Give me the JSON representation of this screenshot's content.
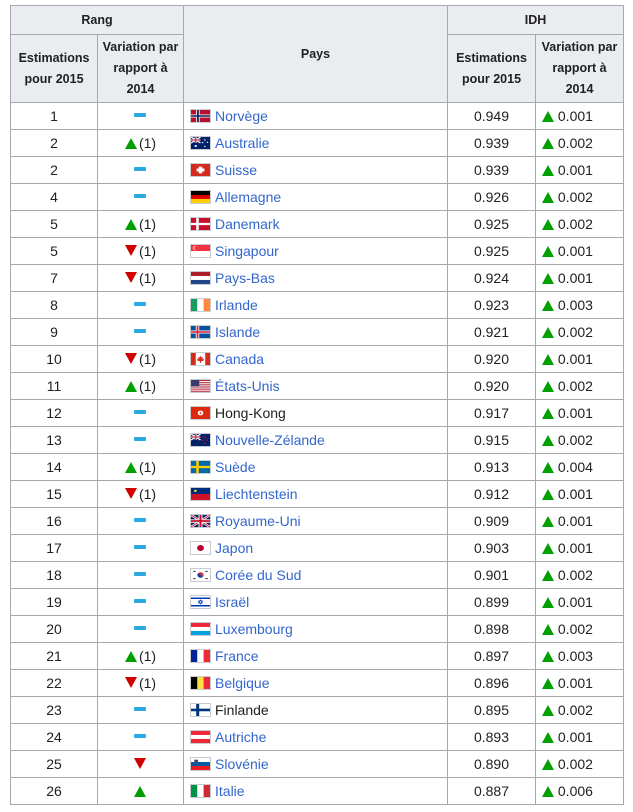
{
  "header": {
    "rang": "Rang",
    "pays": "Pays",
    "idh": "IDH",
    "estimations": "Estimations pour 2015",
    "variation": "Variation par rapport à 2014"
  },
  "colors": {
    "up": "#00a000",
    "down": "#d00000",
    "same": "#2aa9e0",
    "link": "#3366cc"
  },
  "rows": [
    {
      "rank": "1",
      "change": "same",
      "change_text": "",
      "country": "Norvège",
      "flag": "norway-flag",
      "idh": "0.949",
      "idh_change": "0.001"
    },
    {
      "rank": "2",
      "change": "up",
      "change_text": "(1)",
      "country": "Australie",
      "flag": "australia-flag",
      "idh": "0.939",
      "idh_change": "0.002"
    },
    {
      "rank": "2",
      "change": "same",
      "change_text": "",
      "country": "Suisse",
      "flag": "switzerland-flag",
      "idh": "0.939",
      "idh_change": "0.001"
    },
    {
      "rank": "4",
      "change": "same",
      "change_text": "",
      "country": "Allemagne",
      "flag": "germany-flag",
      "idh": "0.926",
      "idh_change": "0.002"
    },
    {
      "rank": "5",
      "change": "up",
      "change_text": "(1)",
      "country": "Danemark",
      "flag": "denmark-flag",
      "idh": "0.925",
      "idh_change": "0.002"
    },
    {
      "rank": "5",
      "change": "down",
      "change_text": "(1)",
      "country": "Singapour",
      "flag": "singapore-flag",
      "idh": "0.925",
      "idh_change": "0.001"
    },
    {
      "rank": "7",
      "change": "down",
      "change_text": "(1)",
      "country": "Pays-Bas",
      "flag": "netherlands-flag",
      "idh": "0.924",
      "idh_change": "0.001"
    },
    {
      "rank": "8",
      "change": "same",
      "change_text": "",
      "country": "Irlande",
      "flag": "ireland-flag",
      "idh": "0.923",
      "idh_change": "0.003"
    },
    {
      "rank": "9",
      "change": "same",
      "change_text": "",
      "country": "Islande",
      "flag": "iceland-flag",
      "idh": "0.921",
      "idh_change": "0.002"
    },
    {
      "rank": "10",
      "change": "down",
      "change_text": "(1)",
      "country": "Canada",
      "flag": "canada-flag",
      "idh": "0.920",
      "idh_change": "0.001"
    },
    {
      "rank": "11",
      "change": "up",
      "change_text": "(1)",
      "country": "États-Unis",
      "flag": "usa-flag",
      "idh": "0.920",
      "idh_change": "0.002"
    },
    {
      "rank": "12",
      "change": "same",
      "change_text": "",
      "country": "Hong-Kong",
      "flag": "hongkong-flag",
      "idh": "0.917",
      "idh_change": "0.001"
    },
    {
      "rank": "13",
      "change": "same",
      "change_text": "",
      "country": "Nouvelle-Zélande",
      "flag": "newzealand-flag",
      "idh": "0.915",
      "idh_change": "0.002"
    },
    {
      "rank": "14",
      "change": "up",
      "change_text": "(1)",
      "country": "Suède",
      "flag": "sweden-flag",
      "idh": "0.913",
      "idh_change": "0.004"
    },
    {
      "rank": "15",
      "change": "down",
      "change_text": "(1)",
      "country": "Liechtenstein",
      "flag": "liechtenstein-flag",
      "idh": "0.912",
      "idh_change": "0.001"
    },
    {
      "rank": "16",
      "change": "same",
      "change_text": "",
      "country": "Royaume-Uni",
      "flag": "uk-flag",
      "idh": "0.909",
      "idh_change": "0.001"
    },
    {
      "rank": "17",
      "change": "same",
      "change_text": "",
      "country": "Japon",
      "flag": "japan-flag",
      "idh": "0.903",
      "idh_change": "0.001"
    },
    {
      "rank": "18",
      "change": "same",
      "change_text": "",
      "country": "Corée du Sud",
      "flag": "southkorea-flag",
      "idh": "0.901",
      "idh_change": "0.002"
    },
    {
      "rank": "19",
      "change": "same",
      "change_text": "",
      "country": "Israël",
      "flag": "israel-flag",
      "idh": "0.899",
      "idh_change": "0.001"
    },
    {
      "rank": "20",
      "change": "same",
      "change_text": "",
      "country": "Luxembourg",
      "flag": "luxembourg-flag",
      "idh": "0.898",
      "idh_change": "0.002"
    },
    {
      "rank": "21",
      "change": "up",
      "change_text": "(1)",
      "country": "France",
      "flag": "france-flag",
      "idh": "0.897",
      "idh_change": "0.003"
    },
    {
      "rank": "22",
      "change": "down",
      "change_text": "(1)",
      "country": "Belgique",
      "flag": "belgium-flag",
      "idh": "0.896",
      "idh_change": "0.001"
    },
    {
      "rank": "23",
      "change": "same",
      "change_text": "",
      "country": "Finlande",
      "flag": "finland-flag",
      "idh": "0.895",
      "idh_change": "0.002"
    },
    {
      "rank": "24",
      "change": "same",
      "change_text": "",
      "country": "Autriche",
      "flag": "austria-flag",
      "idh": "0.893",
      "idh_change": "0.001"
    },
    {
      "rank": "25",
      "change": "down",
      "change_text": "",
      "country": "Slovénie",
      "flag": "slovenia-flag",
      "idh": "0.890",
      "idh_change": "0.002"
    },
    {
      "rank": "26",
      "change": "up",
      "change_text": "",
      "country": "Italie",
      "flag": "italy-flag",
      "idh": "0.887",
      "idh_change": "0.006"
    }
  ]
}
